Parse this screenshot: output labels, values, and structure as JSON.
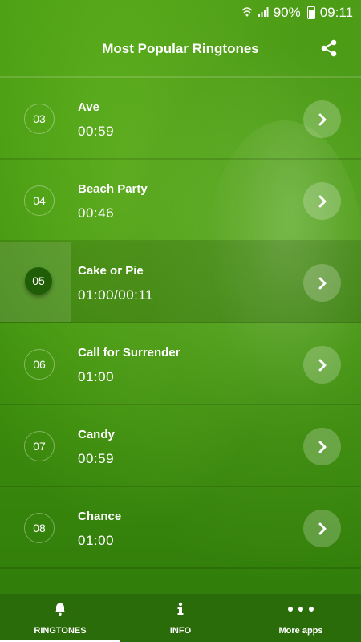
{
  "status": {
    "battery_percent": "90%",
    "time": "09:11"
  },
  "header": {
    "title": "Most Popular Ringtones"
  },
  "ringtones": [
    {
      "number": "03",
      "name": "Ave",
      "duration": "00:59"
    },
    {
      "number": "04",
      "name": "Beach Party",
      "duration": "00:46"
    },
    {
      "number": "05",
      "name": "Cake or Pie",
      "duration": "01:00/00:11",
      "playing": true
    },
    {
      "number": "06",
      "name": "Call for Surrender",
      "duration": "01:00"
    },
    {
      "number": "07",
      "name": "Candy",
      "duration": "00:59"
    },
    {
      "number": "08",
      "name": "Chance",
      "duration": "01:00"
    }
  ],
  "nav": {
    "ringtones": "RINGTONES",
    "info": "INFO",
    "more": "More apps"
  },
  "icons": {
    "share": "share-icon",
    "arrow": "chevron-right-icon",
    "bell": "bell-icon",
    "info": "info-icon",
    "more": "more-dots-icon"
  },
  "colors": {
    "background": "#43950f",
    "nav": "#2a6b0a",
    "playing_badge": "#1f5e06"
  }
}
